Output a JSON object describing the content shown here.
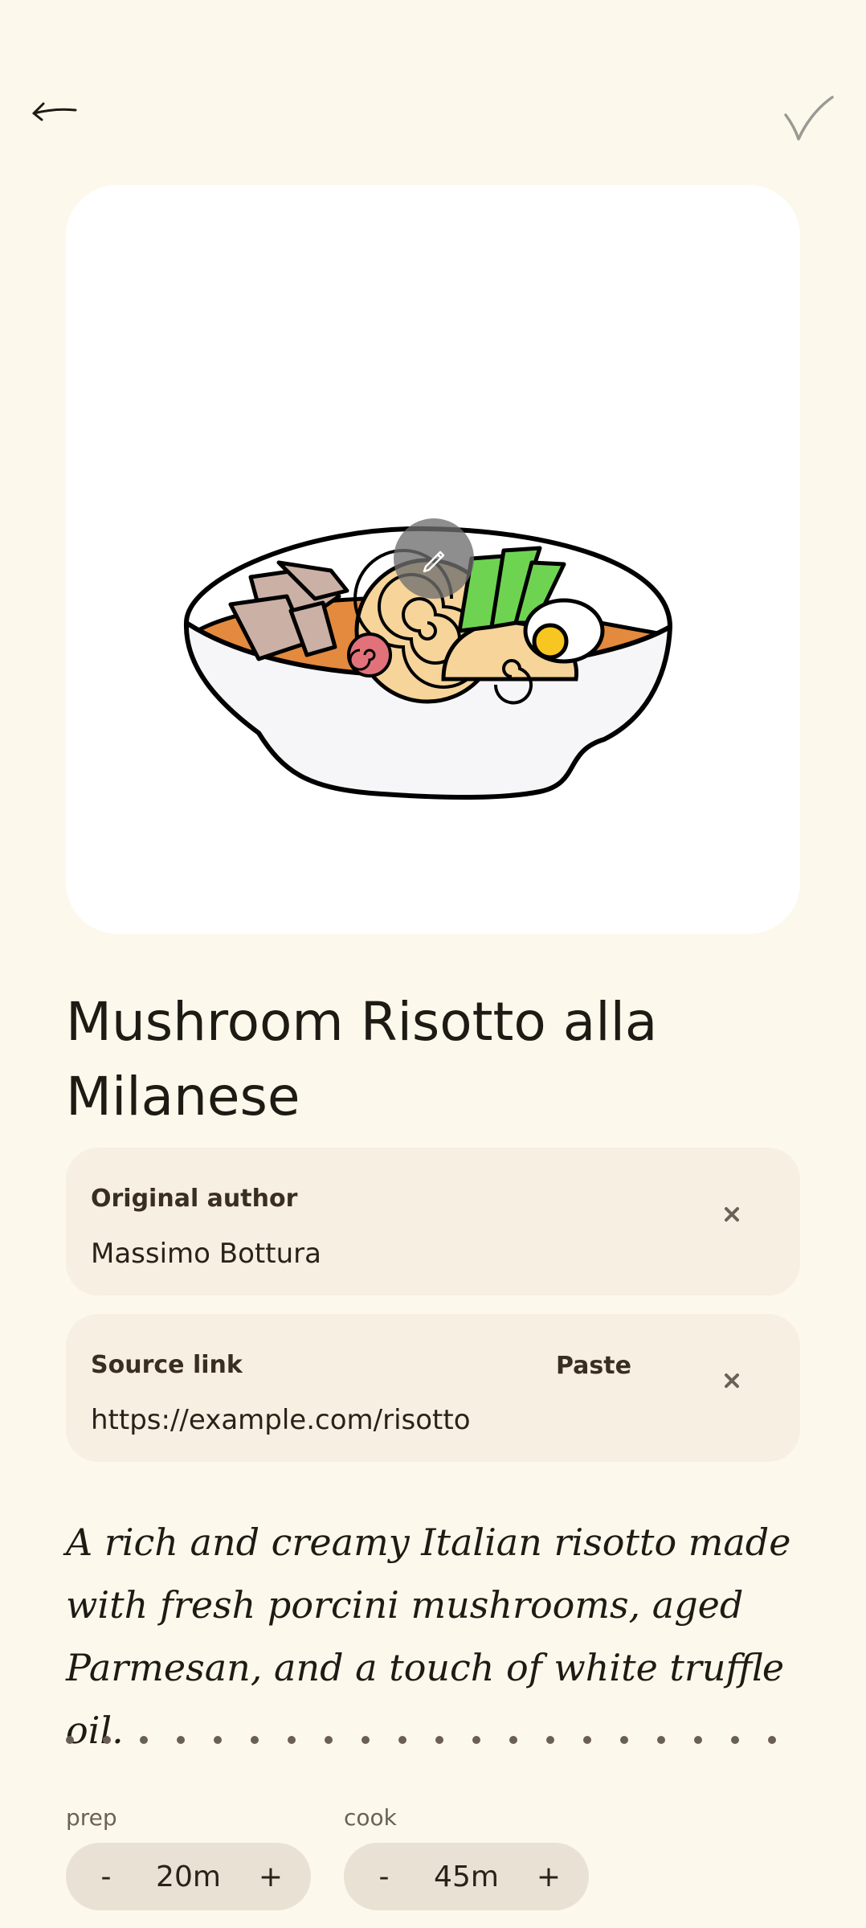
{
  "recipe": {
    "title": "Mushroom Risotto alla Milanese",
    "description": "A rich and creamy Italian risotto made with fresh porcini mushrooms, aged Parmesan, and a touch of white truffle oil."
  },
  "fields": {
    "author": {
      "label": "Original author",
      "value": "Massimo Bottura"
    },
    "source": {
      "label": "Source link",
      "value": "https://example.com/risotto",
      "paste_label": "Paste"
    }
  },
  "timers": {
    "prep": {
      "label": "prep",
      "value": "20m",
      "minus": "-",
      "plus": "+"
    },
    "cook": {
      "label": "cook",
      "value": "45m",
      "minus": "-",
      "plus": "+"
    }
  },
  "icons": {
    "back": "arrow-left-icon",
    "save": "check-icon",
    "edit_photo": "pencil-icon",
    "clear": "close-icon"
  },
  "colors": {
    "background": "#fdf8ec",
    "field_background": "#f7efe2",
    "stepper_background": "#e9e1d3",
    "text": "#1e1a14"
  }
}
